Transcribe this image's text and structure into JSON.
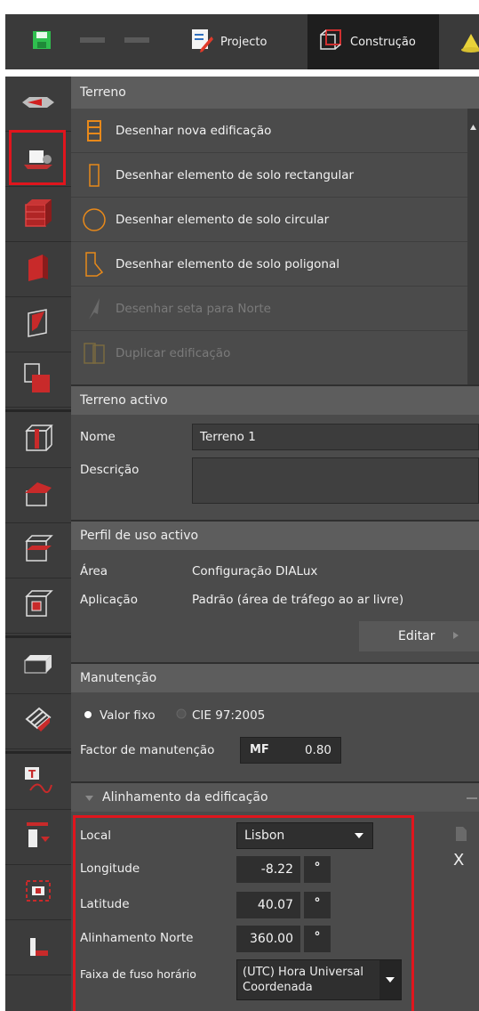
{
  "toolbar": {
    "project_tab": "Projecto",
    "construction_tab": "Construção"
  },
  "sidebar": {
    "items": [
      "arrow-right-icon",
      "ground-element-icon",
      "building-icon",
      "wall-icon",
      "wall-opening-icon",
      "room-icon",
      "column-icon",
      "roof-icon",
      "floor-icon",
      "door-icon",
      "cubicle-icon",
      "stairs-icon",
      "text-icon",
      "window-icon",
      "frame-icon",
      "measure-icon"
    ]
  },
  "terrain": {
    "title": "Terreno",
    "commands": [
      {
        "label": "Desenhar nova edificação",
        "disabled": false
      },
      {
        "label": "Desenhar elemento de solo rectangular",
        "disabled": false
      },
      {
        "label": "Desenhar elemento de solo circular",
        "disabled": false
      },
      {
        "label": "Desenhar elemento de solo poligonal",
        "disabled": false
      },
      {
        "label": "Desenhar seta para Norte",
        "disabled": true
      },
      {
        "label": "Duplicar edificação",
        "disabled": true
      }
    ]
  },
  "active_terrain": {
    "title": "Terreno activo",
    "name_label": "Nome",
    "name_value": "Terreno 1",
    "description_label": "Descrição",
    "description_value": ""
  },
  "usage_profile": {
    "title": "Perfil de uso activo",
    "area_label": "Área",
    "area_value": "Configuração DIALux",
    "application_label": "Aplicação",
    "application_value": "Padrão (área de tráfego ao ar livre)",
    "edit_button": "Editar"
  },
  "maintenance": {
    "title": "Manutenção",
    "option_fixed": "Valor fixo",
    "option_cie": "CIE 97:2005",
    "factor_label": "Factor de manutenção",
    "factor_prefix": "MF",
    "factor_value": "0.80"
  },
  "alignment": {
    "title": "Alinhamento da edificação",
    "location_label": "Local",
    "location_value": "Lisbon",
    "longitude_label": "Longitude",
    "longitude_value": "-8.22",
    "latitude_label": "Latitude",
    "latitude_value": "40.07",
    "north_label": "Alinhamento Norte",
    "north_value": "360.00",
    "degree_unit": "°",
    "timezone_label": "Faixa de fuso horário",
    "timezone_value_line1": "(UTC) Hora Universal",
    "timezone_value_line2": "Coordenada",
    "close_glyph": "X"
  },
  "colors": {
    "highlight": "#e0151d",
    "accent_orange": "#e8891a",
    "panel": "#4b4b4b",
    "header": "#5d5d5d"
  }
}
